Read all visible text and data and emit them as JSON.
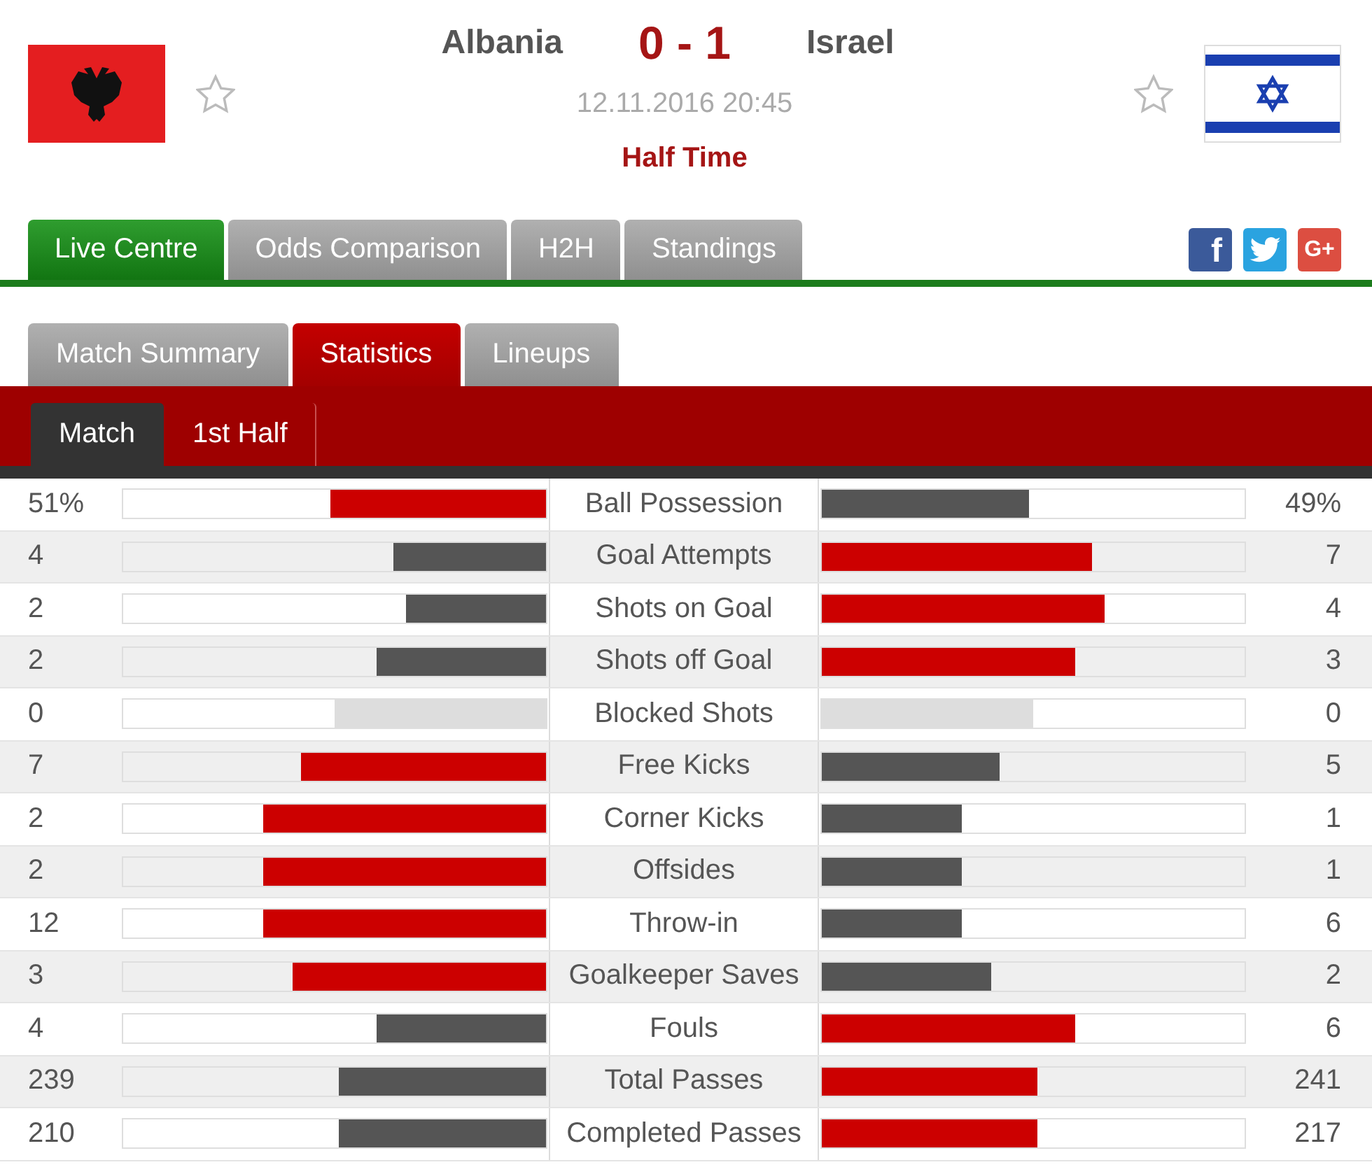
{
  "match": {
    "home": {
      "name": "Albania",
      "flag": {
        "kind": "albania"
      },
      "favorite": false
    },
    "score": "0 - 1",
    "away": {
      "name": "Israel",
      "flag": {
        "kind": "israel"
      },
      "favorite": false
    },
    "datetime": "12.11.2016 20:45",
    "status": "Half Time"
  },
  "main_tabs": [
    {
      "label": "Live Centre",
      "selected": true
    },
    {
      "label": "Odds Comparison",
      "selected": false
    },
    {
      "label": "H2H",
      "selected": false
    },
    {
      "label": "Standings",
      "selected": false
    }
  ],
  "share_buttons": [
    {
      "kind": "facebook",
      "label": "f"
    },
    {
      "kind": "twitter"
    },
    {
      "kind": "google",
      "label": "G+"
    }
  ],
  "section_tabs": [
    {
      "label": "Match Summary",
      "selected": false
    },
    {
      "label": "Statistics",
      "selected": true
    },
    {
      "label": "Lineups",
      "selected": false
    }
  ],
  "period_tabs": [
    {
      "label": "Match",
      "selected": true
    },
    {
      "label": "1st Half",
      "selected": false
    }
  ],
  "statistics": [
    {
      "name": "Ball Possession",
      "home": {
        "value": "51%",
        "level": 0.51,
        "kind": "lead"
      },
      "away": {
        "value": "49%",
        "level": 0.49,
        "kind": "trail"
      }
    },
    {
      "name": "Goal Attempts",
      "home": {
        "value": "4",
        "level": 0.36,
        "kind": "trail"
      },
      "away": {
        "value": "7",
        "level": 0.64,
        "kind": "lead"
      }
    },
    {
      "name": "Shots on Goal",
      "home": {
        "value": "2",
        "level": 0.33,
        "kind": "trail"
      },
      "away": {
        "value": "4",
        "level": 0.67,
        "kind": "lead"
      }
    },
    {
      "name": "Shots off Goal",
      "home": {
        "value": "2",
        "level": 0.4,
        "kind": "trail"
      },
      "away": {
        "value": "3",
        "level": 0.6,
        "kind": "lead"
      }
    },
    {
      "name": "Blocked Shots",
      "home": {
        "value": "0",
        "level": 0.5,
        "kind": "even"
      },
      "away": {
        "value": "0",
        "level": 0.5,
        "kind": "even"
      }
    },
    {
      "name": "Free Kicks",
      "home": {
        "value": "7",
        "level": 0.58,
        "kind": "lead"
      },
      "away": {
        "value": "5",
        "level": 0.42,
        "kind": "trail"
      }
    },
    {
      "name": "Corner Kicks",
      "home": {
        "value": "2",
        "level": 0.67,
        "kind": "lead"
      },
      "away": {
        "value": "1",
        "level": 0.33,
        "kind": "trail"
      }
    },
    {
      "name": "Offsides",
      "home": {
        "value": "2",
        "level": 0.67,
        "kind": "lead"
      },
      "away": {
        "value": "1",
        "level": 0.33,
        "kind": "trail"
      }
    },
    {
      "name": "Throw-in",
      "home": {
        "value": "12",
        "level": 0.67,
        "kind": "lead"
      },
      "away": {
        "value": "6",
        "level": 0.33,
        "kind": "trail"
      }
    },
    {
      "name": "Goalkeeper Saves",
      "home": {
        "value": "3",
        "level": 0.6,
        "kind": "lead"
      },
      "away": {
        "value": "2",
        "level": 0.4,
        "kind": "trail"
      }
    },
    {
      "name": "Fouls",
      "home": {
        "value": "4",
        "level": 0.4,
        "kind": "trail"
      },
      "away": {
        "value": "6",
        "level": 0.6,
        "kind": "lead"
      }
    },
    {
      "name": "Total Passes",
      "home": {
        "value": "239",
        "level": 0.49,
        "kind": "trail"
      },
      "away": {
        "value": "241",
        "level": 0.51,
        "kind": "lead"
      }
    },
    {
      "name": "Completed Passes",
      "home": {
        "value": "210",
        "level": 0.49,
        "kind": "trail"
      },
      "away": {
        "value": "217",
        "level": 0.51,
        "kind": "lead"
      }
    }
  ]
}
